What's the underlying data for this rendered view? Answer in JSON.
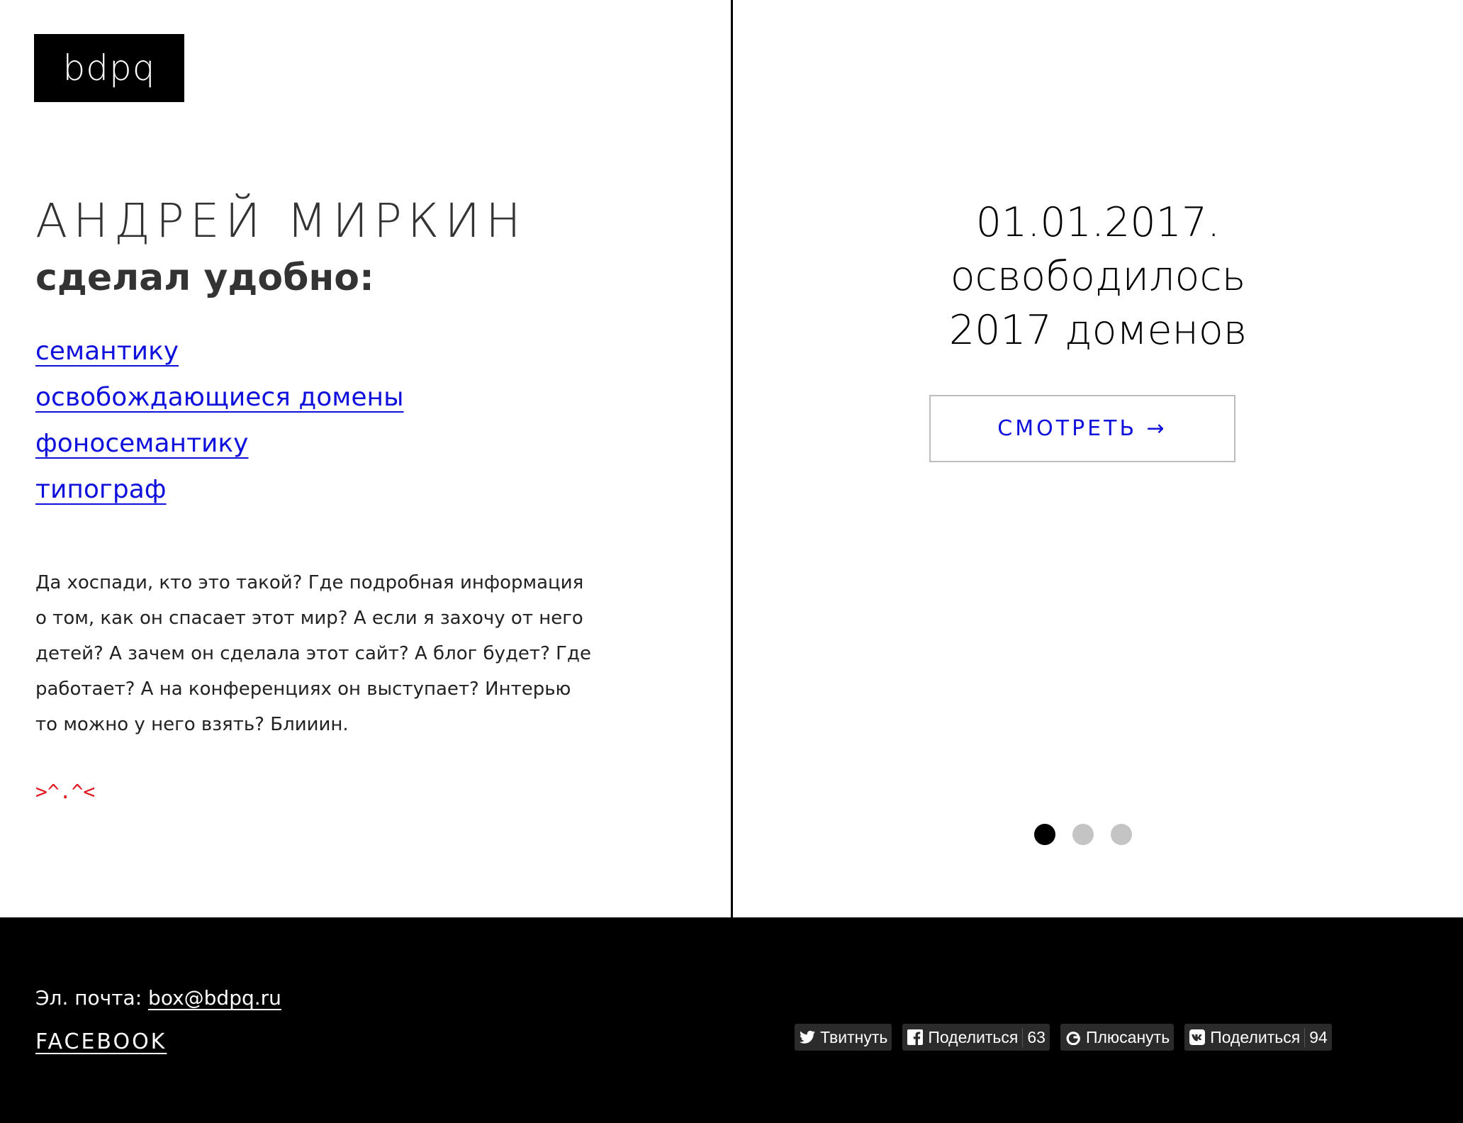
{
  "logo": {
    "text": "bdpq"
  },
  "hero": {
    "name": "АНДРЕЙ МИРКИН",
    "subtitle": "сделал удобно:"
  },
  "tools": [
    {
      "label": "семантику"
    },
    {
      "label": "освобождающиеся домены"
    },
    {
      "label": "фоносемантику"
    },
    {
      "label": "типограф"
    }
  ],
  "about": {
    "lines": [
      "Да хоспади, кто это такой? Где подробная информация",
      "о том, как он спасает этот мир? А если я захочу от него",
      "детей? А зачем он сделала этот сайт? А блог будет? Где",
      "работает? А на конференциях он выступает? Интерью",
      "то можно у него взять? Блииин."
    ]
  },
  "kaomoji": ">^.^<",
  "slider": {
    "lines": [
      "01.01.2017.",
      "освободилось",
      "2017 доменов"
    ],
    "cta_label": "СМОТРЕТЬ →",
    "active_slide": 1,
    "slide_count": 3
  },
  "footer": {
    "email_label": "Эл. почта:",
    "email": "box@bdpq.ru",
    "facebook_label": "FACEBOOK",
    "share": [
      {
        "icon": "twitter-icon",
        "label": "Твитнуть"
      },
      {
        "icon": "facebook-icon",
        "label": "Поделиться",
        "count": "63"
      },
      {
        "icon": "google-plus-icon",
        "label": "Плюсануть"
      },
      {
        "icon": "vk-icon",
        "label": "Поделиться",
        "count": "94"
      }
    ]
  },
  "colors": {
    "link": "#1010dd",
    "kaomoji": "#e0141e",
    "footer_bg": "#000000",
    "dot_inactive": "#c4c4c4",
    "dot_active": "#000000"
  }
}
